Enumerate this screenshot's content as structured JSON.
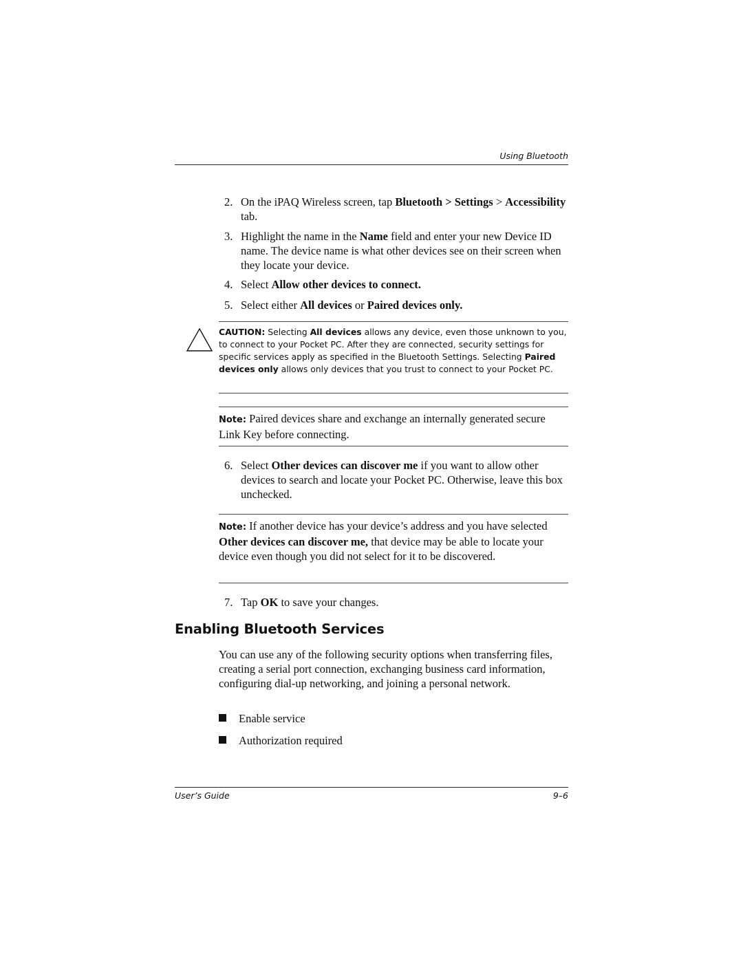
{
  "header": {
    "running_title": "Using Bluetooth"
  },
  "steps_top": [
    {
      "num": "2.",
      "parts": [
        {
          "t": "On the iPAQ Wireless screen, tap ",
          "b": false
        },
        {
          "t": "Bluetooth > Settings",
          "b": true
        },
        {
          "t": " > ",
          "b": false
        },
        {
          "t": "Accessibility",
          "b": true
        },
        {
          "t": " tab.",
          "b": false
        }
      ]
    },
    {
      "num": "3.",
      "parts": [
        {
          "t": "Highlight the name in the ",
          "b": false
        },
        {
          "t": "Name",
          "b": true
        },
        {
          "t": " field and enter your new Device ID name. The device name is what other devices see on their screen when they locate your device.",
          "b": false
        }
      ]
    },
    {
      "num": "4.",
      "parts": [
        {
          "t": "Select ",
          "b": false
        },
        {
          "t": "Allow other devices to connect.",
          "b": true
        }
      ]
    },
    {
      "num": "5.",
      "parts": [
        {
          "t": "Select either ",
          "b": false
        },
        {
          "t": "All devices",
          "b": true
        },
        {
          "t": " or ",
          "b": false
        },
        {
          "t": "Paired devices only.",
          "b": true
        }
      ]
    }
  ],
  "caution": {
    "icon": "warning-triangle-icon",
    "label": "CAUTION:",
    "parts": [
      {
        "t": " Selecting ",
        "b": false
      },
      {
        "t": "All devices",
        "b": true
      },
      {
        "t": " allows any device, even those unknown to you, to connect to your Pocket PC. After they are connected, security settings for specific services apply as specified in the Bluetooth Settings. Selecting ",
        "b": false
      },
      {
        "t": "Paired devices only",
        "b": true
      },
      {
        "t": " allows only devices that you trust to connect to your Pocket PC.",
        "b": false
      }
    ]
  },
  "note1": {
    "label": "Note:",
    "parts": [
      {
        "t": " Paired devices share and exchange an internally generated secure Link Key before connecting.",
        "b": false
      }
    ]
  },
  "step6": {
    "num": "6.",
    "parts": [
      {
        "t": "Select ",
        "b": false
      },
      {
        "t": "Other devices can discover me",
        "b": true
      },
      {
        "t": " if you want to allow other devices to search and locate your Pocket PC. Otherwise, leave this box unchecked.",
        "b": false
      }
    ]
  },
  "note2": {
    "label": "Note:",
    "parts": [
      {
        "t": " If another device has your device’s address and you have selected ",
        "b": false
      },
      {
        "t": "Other devices can discover me,",
        "b": true
      },
      {
        "t": " that device may be able to locate your device even though you did not select for it to be discovered.",
        "b": false
      }
    ]
  },
  "step7": {
    "num": "7.",
    "parts": [
      {
        "t": "Tap ",
        "b": false
      },
      {
        "t": "OK",
        "b": true
      },
      {
        "t": " to save your changes.",
        "b": false
      }
    ]
  },
  "section": {
    "heading": "Enabling Bluetooth Services",
    "paragraph": "You can use any of the following security options when transferring files, creating a serial port connection, exchanging business card information, configuring dial-up networking, and joining a personal network.",
    "bullets": [
      "Enable service",
      "Authorization required"
    ]
  },
  "footer": {
    "left": "User’s Guide",
    "right": "9–6"
  }
}
